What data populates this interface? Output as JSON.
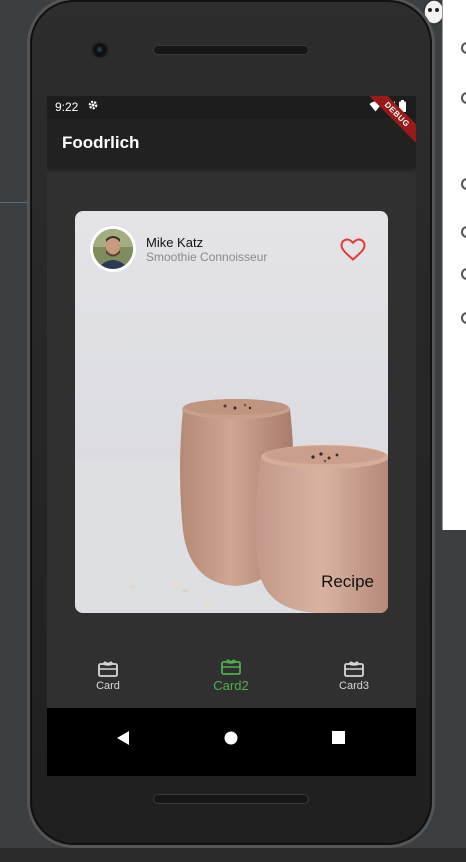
{
  "status_bar": {
    "time": "9:22"
  },
  "app_bar": {
    "title": "Foodrlich",
    "debug_banner": "DEBUG"
  },
  "card": {
    "author_name": "Mike Katz",
    "author_title": "Smoothie Connoisseur",
    "label": "Recipe"
  },
  "bottom_nav": {
    "items": [
      {
        "label": "Card",
        "icon": "card-giftcard-icon",
        "active": false
      },
      {
        "label": "Card2",
        "icon": "card-giftcard-icon",
        "active": true
      },
      {
        "label": "Card3",
        "icon": "card-giftcard-icon",
        "active": false
      }
    ]
  },
  "colors": {
    "active_nav": "#4caf50",
    "heart": "#e53935",
    "app_bar": "#212121",
    "screen_bg": "#303030"
  }
}
